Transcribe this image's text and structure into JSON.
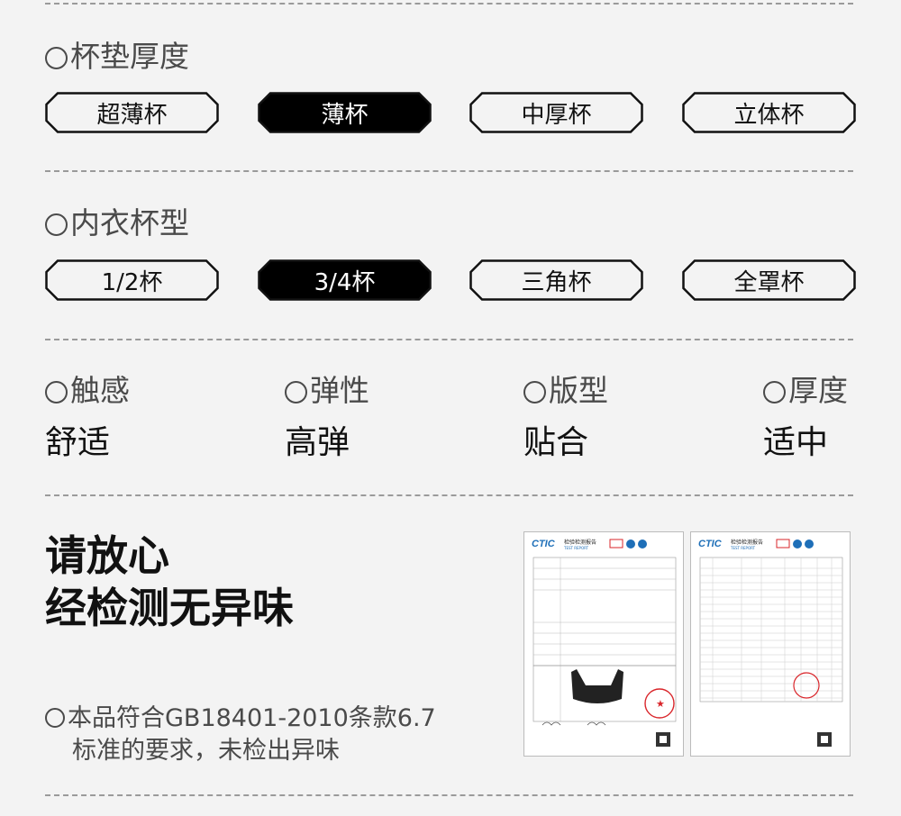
{
  "cup_thickness": {
    "title": "杯垫厚度",
    "options": [
      {
        "label": "超薄杯",
        "selected": false
      },
      {
        "label": "薄杯",
        "selected": true
      },
      {
        "label": "中厚杯",
        "selected": false
      },
      {
        "label": "立体杯",
        "selected": false
      }
    ]
  },
  "cup_type": {
    "title": "内衣杯型",
    "options": [
      {
        "label": "1/2杯",
        "selected": false
      },
      {
        "label": "3/4杯",
        "selected": true
      },
      {
        "label": "三角杯",
        "selected": false
      },
      {
        "label": "全罩杯",
        "selected": false
      }
    ]
  },
  "properties": [
    {
      "label": "触感",
      "value": "舒适"
    },
    {
      "label": "弹性",
      "value": "高弹"
    },
    {
      "label": "版型",
      "value": "贴合"
    },
    {
      "label": "厚度",
      "value": "适中"
    }
  ],
  "assurance": {
    "headline_line1": "请放心",
    "headline_line2": "经检测无异味",
    "note_line1": "本品符合GB18401-2010条款6.7",
    "note_line2": "标准的要求，未检出异味"
  },
  "reports": {
    "logo": "CTIC",
    "org": "检验检测报告",
    "sub": "TEST REPORT"
  },
  "colors": {
    "selected_bg": "#000000",
    "border": "#111111",
    "page_bg": "#f3f3f3",
    "stamp": "#d9252a"
  }
}
